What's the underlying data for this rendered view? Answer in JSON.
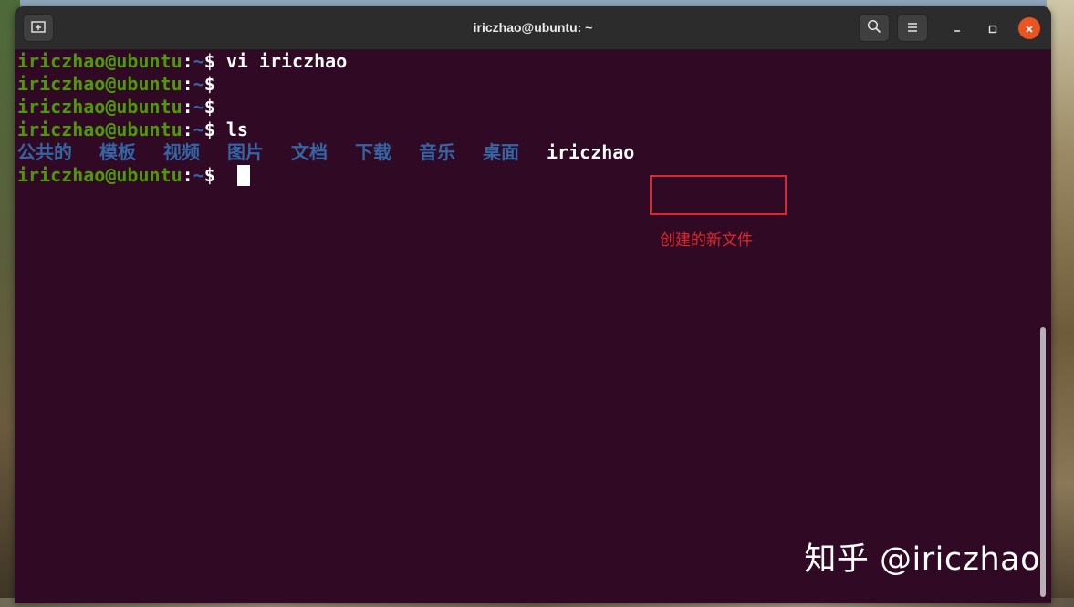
{
  "window": {
    "title": "iriczhao@ubuntu: ~"
  },
  "titlebar": {
    "new_tab_icon": "new-tab-icon",
    "search_icon": "search-icon",
    "menu_icon": "hamburger-menu-icon",
    "minimize_icon": "minimize-icon",
    "maximize_icon": "maximize-icon",
    "close_icon": "close-icon"
  },
  "terminal": {
    "colors": {
      "background": "#300a24",
      "user_host": "#4e9a06",
      "path_and_dirs": "#3465a4",
      "text": "#ffffff"
    },
    "lines": [
      {
        "user": "iriczhao@ubuntu",
        "colon": ":",
        "path": "~",
        "prompt": "$ ",
        "command": "vi iriczhao"
      },
      {
        "user": "iriczhao@ubuntu",
        "colon": ":",
        "path": "~",
        "prompt": "$",
        "command": ""
      },
      {
        "user": "iriczhao@ubuntu",
        "colon": ":",
        "path": "~",
        "prompt": "$",
        "command": ""
      },
      {
        "user": "iriczhao@ubuntu",
        "colon": ":",
        "path": "~",
        "prompt": "$ ",
        "command": "ls"
      }
    ],
    "ls_output": {
      "directories": [
        "公共的",
        "模板",
        "视频",
        "图片",
        "文档",
        "下载",
        "音乐",
        "桌面"
      ],
      "file": "iriczhao"
    },
    "active_prompt": {
      "user": "iriczhao@ubuntu",
      "colon": ":",
      "path": "~",
      "prompt": "$ "
    }
  },
  "annotation": {
    "text": "创建的新文件",
    "color": "#e0262c"
  },
  "watermark": {
    "text": "知乎 @iriczhao"
  }
}
